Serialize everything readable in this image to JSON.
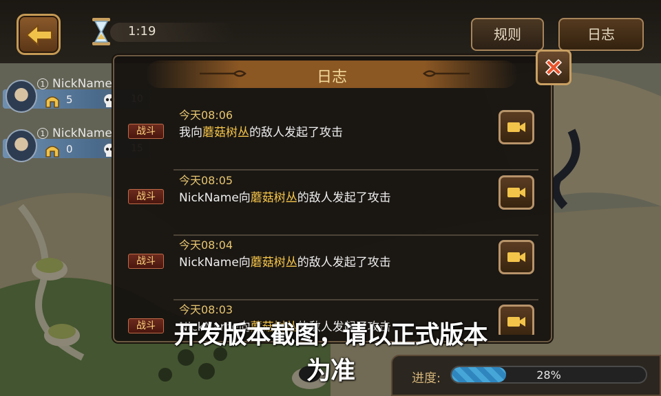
{
  "timer": "1:19",
  "top_buttons": {
    "rules": "规则",
    "log": "日志"
  },
  "players": [
    {
      "level": "1",
      "name": "NickName",
      "value1": "5",
      "value2": "10"
    },
    {
      "level": "1",
      "name": "NickName",
      "value1": "0",
      "value2": "15"
    }
  ],
  "dialog": {
    "title": "日志",
    "entries": [
      {
        "time": "今天08:06",
        "tag": "战斗",
        "pre": "我向",
        "place": "蘑菇树丛",
        "post": "的敌人发起了攻击"
      },
      {
        "time": "今天08:05",
        "tag": "战斗",
        "pre": "NickName向",
        "place": "蘑菇树丛",
        "post": "的敌人发起了攻击"
      },
      {
        "time": "今天08:04",
        "tag": "战斗",
        "pre": "NickName向",
        "place": "蘑菇树丛",
        "post": "的敌人发起了攻击"
      },
      {
        "time": "今天08:03",
        "tag": "战斗",
        "pre": "NickName向",
        "place": "蘑菇树丛",
        "post": "的敌人发起了攻击"
      }
    ]
  },
  "progress": {
    "label": "进度:",
    "value": 0.28,
    "text": "28%"
  },
  "watermark": "开发版本截图，请以正式版本为准",
  "icons": {
    "back": "back-arrow-icon",
    "timer": "hourglass-icon",
    "close": "close-icon",
    "helmet": "helmet-icon",
    "skull": "skull-icon",
    "replay": "video-camera-icon"
  },
  "colors": {
    "gold": "#f5c54a",
    "tag_red": "#6b2a1d",
    "progress_blue": "#46a6d8"
  }
}
